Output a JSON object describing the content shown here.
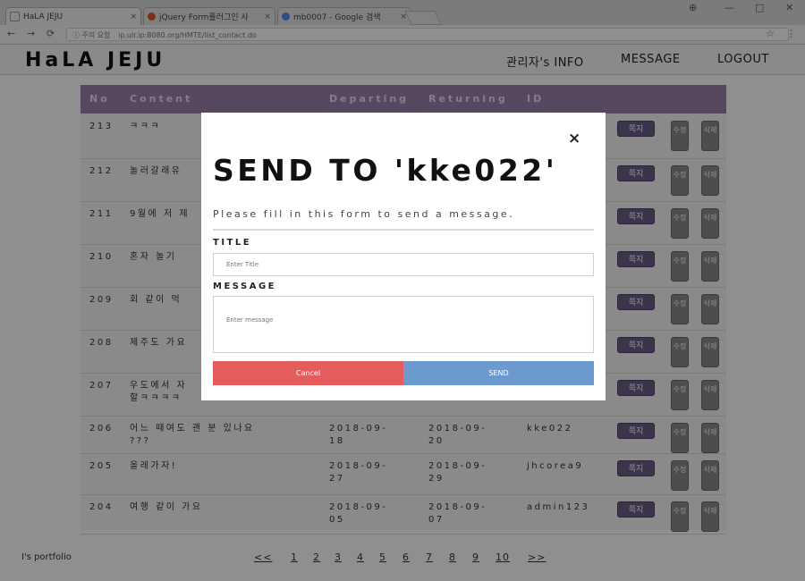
{
  "browser": {
    "tabs": [
      {
        "title": "HaLA JEJU",
        "fav_color": "#bbbbbb"
      },
      {
        "title": "jQuery Form플러그인 사",
        "fav_color": "#e2572a"
      },
      {
        "title": "mb0007 - Google 검색",
        "fav_color": "#4a8df0"
      }
    ],
    "tab_close": "×",
    "window_controls": [
      "⊕",
      "—",
      "□",
      "✕"
    ],
    "nav": {
      "back": "←",
      "forward": "→",
      "reload": "⟳"
    },
    "security": "ⓘ 주의 요함",
    "url": "ip.ulr.ip:8080.org/HMTE/list_contact.do",
    "star": "☆",
    "menu": "⋮"
  },
  "header": {
    "logo": "HaLA JEJU",
    "nav": [
      "관리자's INFO",
      "MESSAGE",
      "LOGOUT"
    ]
  },
  "board": {
    "columns": [
      "No",
      "Content",
      "Departing",
      "Returning",
      "ID"
    ],
    "rows": [
      {
        "no": "213",
        "content": "ㅋㅋㅋ",
        "dep": "",
        "ret": "",
        "id": ""
      },
      {
        "no": "212",
        "content": "놀러갈래유",
        "dep": "",
        "ret": "",
        "id": ""
      },
      {
        "no": "211",
        "content": "9월에 저 제",
        "dep": "",
        "ret": "",
        "id": ""
      },
      {
        "no": "210",
        "content": "혼자 놀기",
        "dep": "",
        "ret": "",
        "id": ""
      },
      {
        "no": "209",
        "content": "회 같이 먹",
        "dep": "",
        "ret": "",
        "id": ""
      },
      {
        "no": "208",
        "content": "제주도 가요",
        "dep": "",
        "ret": "",
        "id": ""
      },
      {
        "no": "207",
        "content": "우도에서 자\n할ㅋㅋㅋㅋ",
        "dep": "",
        "ret": "",
        "id": ""
      },
      {
        "no": "206",
        "content": "어느 때여도 괜 분 있나요\n???",
        "dep": "2018-09-\n18",
        "ret": "2018-09-\n20",
        "id": "kke022"
      },
      {
        "no": "205",
        "content": "올레가자!",
        "dep": "2018-09-\n27",
        "ret": "2018-09-\n29",
        "id": "jhcorea9"
      },
      {
        "no": "204",
        "content": "여행 같이 가요",
        "dep": "2018-09-\n05",
        "ret": "2018-09-\n07",
        "id": "admin123"
      }
    ],
    "reply_label": "쪽지",
    "edit_label": "수정",
    "delete_label": "삭제"
  },
  "footer": {
    "portfolio": "I's portfolio",
    "pages": [
      "<<",
      "1",
      "2",
      "3",
      "4",
      "5",
      "6",
      "7",
      "8",
      "9",
      "10",
      ">>"
    ]
  },
  "modal": {
    "close": "×",
    "title": "SEND TO 'kke022'",
    "subtitle": "Please fill in this form to send a message.",
    "title_label": "TITLE",
    "title_placeholder": "Enter Title",
    "message_label": "MESSAGE",
    "message_placeholder": "Enter message",
    "cancel_label": "Cancel",
    "send_label": "SEND"
  }
}
